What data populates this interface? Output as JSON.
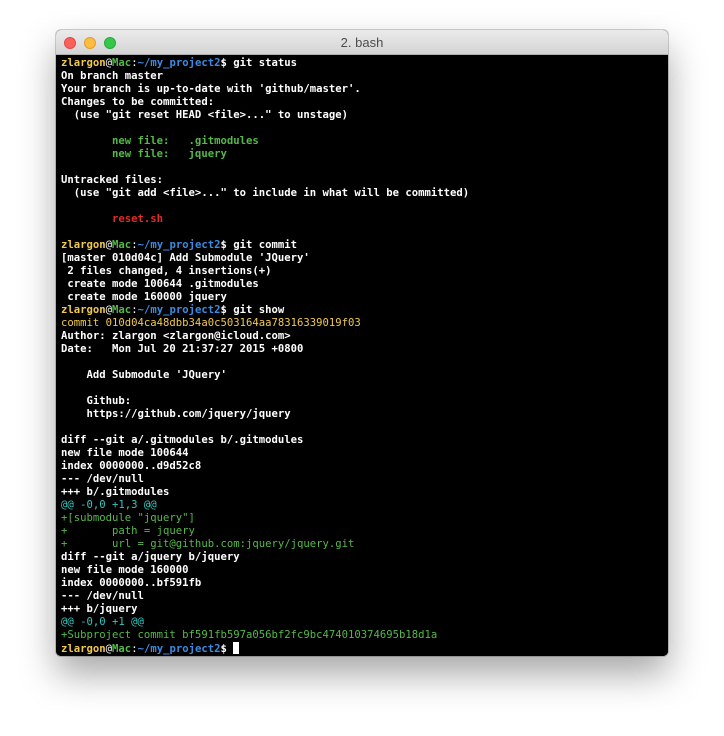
{
  "window": {
    "title": "2. bash"
  },
  "prompt": {
    "user": "zlargon",
    "at": "@",
    "host": "Mac",
    "colon": ":",
    "path": "~/my_project2",
    "dollar": "$ "
  },
  "commands": {
    "status": "git status",
    "commit": "git commit",
    "show": "git show"
  },
  "status_output": {
    "branch": "On branch master",
    "uptodate": "Your branch is up-to-date with 'github/master'.",
    "changes_header": "Changes to be committed:",
    "changes_hint": "  (use \"git reset HEAD <file>...\" to unstage)",
    "staged_files": [
      "        new file:   .gitmodules",
      "        new file:   jquery"
    ],
    "untracked_header": "Untracked files:",
    "untracked_hint": "  (use \"git add <file>...\" to include in what will be committed)",
    "untracked_files": [
      "        reset.sh"
    ]
  },
  "commit_output": [
    "[master 010d04c] Add Submodule 'JQuery'",
    " 2 files changed, 4 insertions(+)",
    " create mode 100644 .gitmodules",
    " create mode 160000 jquery"
  ],
  "show_output": {
    "commit_line": "commit 010d04ca48dbb34a0c503164aa78316339019f03",
    "author": "Author: zlargon <zlargon@icloud.com>",
    "date": "Date:   Mon Jul 20 21:37:27 2015 +0800",
    "message": [
      "    Add Submodule 'JQuery'",
      "",
      "    Github:",
      "    https://github.com/jquery/jquery"
    ],
    "diff1": {
      "header": "diff --git a/.gitmodules b/.gitmodules",
      "mode": "new file mode 100644",
      "index": "index 0000000..d9d52c8",
      "minus": "--- /dev/null",
      "plus": "+++ b/.gitmodules",
      "hunk": "@@ -0,0 +1,3 @@",
      "added": [
        "+[submodule \"jquery\"]",
        "+       path = jquery",
        "+       url = git@github.com:jquery/jquery.git"
      ]
    },
    "diff2": {
      "header": "diff --git a/jquery b/jquery",
      "mode": "new file mode 160000",
      "index": "index 0000000..bf591fb",
      "minus": "--- /dev/null",
      "plus": "+++ b/jquery",
      "hunk": "@@ -0,0 +1 @@",
      "added": [
        "+Subproject commit bf591fb597a056bf2fc9bc474010374695b18d1a"
      ]
    }
  },
  "colors": {
    "background": "#000000",
    "prompt_user": "#f2c94c",
    "prompt_host": "#56b84a",
    "prompt_path": "#3d8be0",
    "staged": "#56b84a",
    "untracked": "#e02c2c",
    "hunk": "#34c6c0"
  }
}
